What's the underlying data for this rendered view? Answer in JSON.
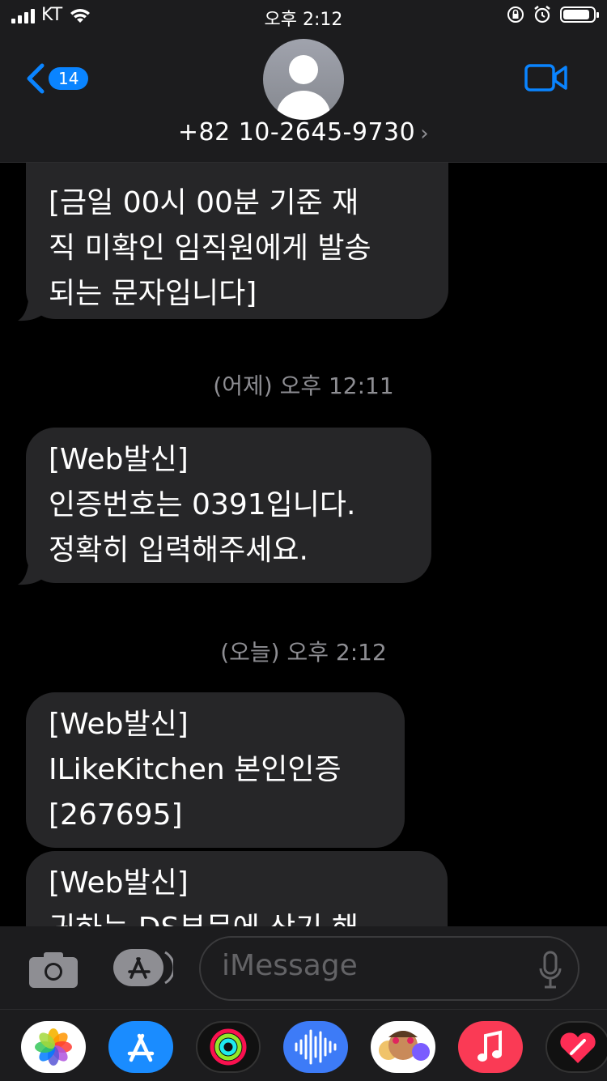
{
  "status_bar": {
    "carrier": "KT",
    "time": "오후 2:12",
    "battery_level": 0.9
  },
  "header": {
    "back_badge": "14",
    "contact": "+82 10-2645-9730",
    "icons": [
      "back-chevron-icon",
      "avatar",
      "video-call-icon"
    ]
  },
  "messages": [
    {
      "type": "received",
      "text": "[금일 00시 00분 기준 재\n직 미확인 임직원에게 발송\n되는 문자입니다]"
    },
    {
      "type": "timestamp",
      "text": "(어제) 오후 12:11"
    },
    {
      "type": "received",
      "text": "[Web발신]\n인증번호는 0391입니다.\n정확히 입력해주세요."
    },
    {
      "type": "timestamp",
      "text": "(오늘) 오후 2:12"
    },
    {
      "type": "received",
      "text": "[Web발신]\nILikeKitchen 본인인증\n[267695]"
    },
    {
      "type": "received",
      "text": "[Web발신]\n귀하는 DS부문에 상기 해"
    }
  ],
  "input": {
    "placeholder": "iMessage"
  },
  "app_drawer": [
    "photos-app",
    "app-store-app",
    "activity-app",
    "audio-message-app",
    "memoji-app",
    "music-app",
    "digital-touch-app"
  ],
  "colors": {
    "accent": "#0a84ff",
    "bubble": "#262628",
    "bar": "#1c1c1e"
  }
}
